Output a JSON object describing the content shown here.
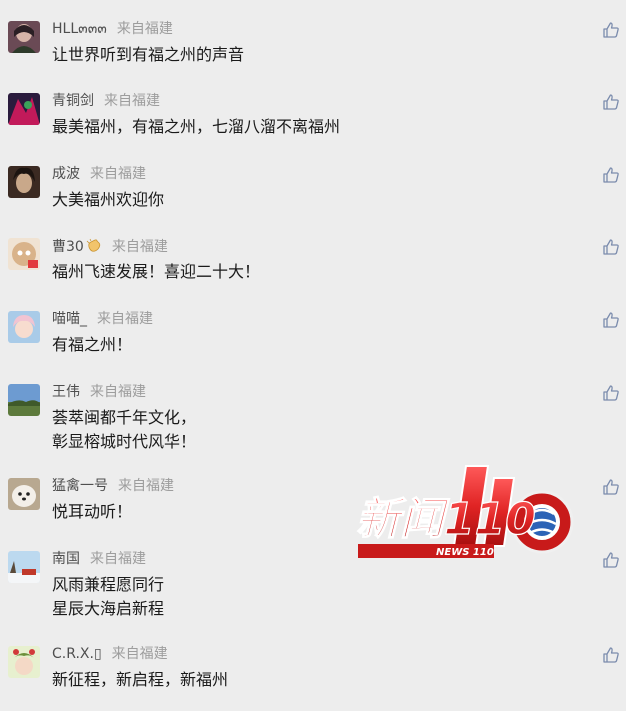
{
  "comments": [
    {
      "nickname": "HLL๓๓๓",
      "location": "来自福建",
      "lines": [
        "让世界听到有福之州的声音"
      ],
      "avatar_colors": [
        "#6a4a55",
        "#2d3a2a"
      ]
    },
    {
      "nickname": "青铜剑",
      "location": "来自福建",
      "lines": [
        "最美福州，有福之州，七溜八溜不离福州"
      ],
      "avatar_colors": [
        "#c21a5a",
        "#2a1b3d"
      ]
    },
    {
      "nickname": "成波",
      "location": "来自福建",
      "lines": [
        "大美福州欢迎你"
      ],
      "avatar_colors": [
        "#3b2a22",
        "#c9a88a"
      ]
    },
    {
      "nickname": "曹30",
      "location": "来自福建",
      "lines": [
        "福州飞速发展！喜迎二十大！"
      ],
      "avatar_colors": [
        "#d9b38a",
        "#e23a3a"
      ],
      "nickname_icon": "clapping-hand-icon"
    },
    {
      "nickname": "喵喵_",
      "location": "来自福建",
      "lines": [
        "有福之州！"
      ],
      "avatar_colors": [
        "#f1c4d2",
        "#a9cbe8"
      ]
    },
    {
      "nickname": "王伟",
      "location": "来自福建",
      "lines": [
        "荟萃闽都千年文化，",
        "彰显榕城时代风华！"
      ],
      "avatar_colors": [
        "#6d9bd1",
        "#5d7a3c"
      ]
    },
    {
      "nickname": "猛禽一号",
      "location": "来自福建",
      "lines": [
        "悦耳动听！"
      ],
      "avatar_colors": [
        "#f3efe9",
        "#b8a890"
      ]
    },
    {
      "nickname": "南国",
      "location": "来自福建",
      "lines": [
        "风雨兼程愿同行",
        "星辰大海启新程"
      ],
      "avatar_colors": [
        "#bcd9ef",
        "#c0392b"
      ]
    },
    {
      "nickname": "C.R.X.▯",
      "location": "来自福建",
      "lines": [
        "新征程，新启程，新福州"
      ],
      "avatar_colors": [
        "#e7f0cf",
        "#6b8f3a"
      ]
    }
  ],
  "icons": {
    "like": "thumbs-up-icon"
  },
  "logo": {
    "main_text": "新闻110",
    "sub_text": "NEWS 110",
    "color": "#e02424"
  }
}
